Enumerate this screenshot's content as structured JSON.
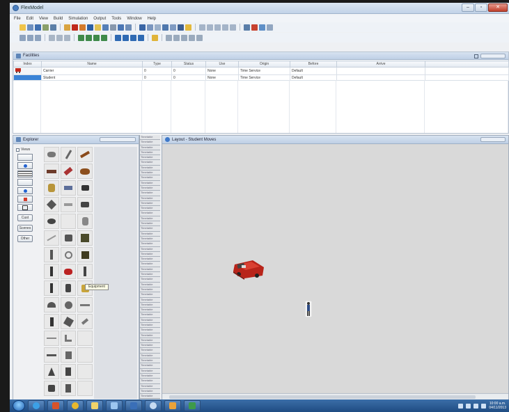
{
  "window": {
    "title": "FlexModel",
    "min": "–",
    "max": "▫",
    "close": "✕"
  },
  "menu": [
    "File",
    "Edit",
    "View",
    "Build",
    "Simulation",
    "Output",
    "Tools",
    "Window",
    "Help"
  ],
  "facilities": {
    "title": "Facilities",
    "columns": [
      "Index",
      "Name",
      "Type",
      "Status",
      "Use",
      "Origin",
      "Before",
      "Arrive"
    ],
    "rows": [
      {
        "index": "",
        "name": "Carrier",
        "type": "0",
        "status": "0",
        "use": "None",
        "origin": "Time Service",
        "before": "Default",
        "arrive": ""
      },
      {
        "index": "",
        "name": "Student",
        "type": "0",
        "status": "0",
        "use": "None",
        "origin": "Time Service",
        "before": "Default",
        "arrive": ""
      }
    ]
  },
  "explorer": {
    "title": "Explorer",
    "categories_label": "Views",
    "buttons": [
      "Cust",
      "Scenes",
      "Other"
    ],
    "tooltip": "Equipment"
  },
  "mid_strip_label": "Timetable",
  "layout": {
    "title": "Layout - Student Moves"
  },
  "taskbar": {
    "time": "10:00 a.m.",
    "date": "04/11/2013"
  },
  "colors": {
    "accent": "#3b83d6",
    "car": "#c0281c",
    "taskbar": "#1f4c82"
  }
}
